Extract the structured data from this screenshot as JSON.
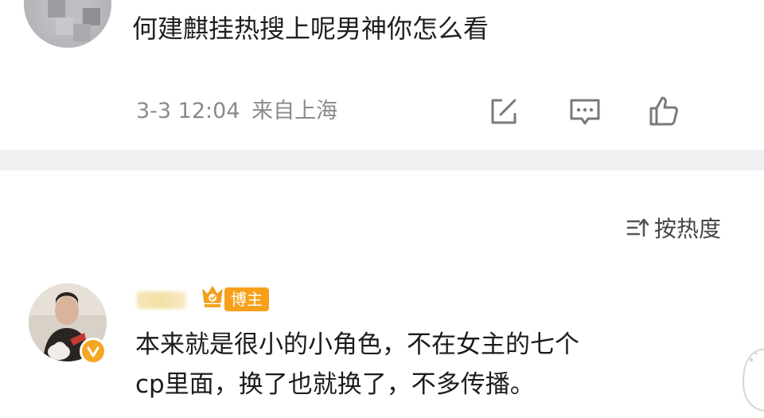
{
  "post": {
    "text": "何建麒挂热搜上呢男神你怎么看",
    "timestamp": "3-3 12:04",
    "location": "来自上海"
  },
  "actions": {
    "share_icon": "share-icon",
    "comment_icon": "comment-icon",
    "like_icon": "thumbs-up-icon"
  },
  "sort": {
    "icon": "sort-icon",
    "label": "按热度"
  },
  "comment": {
    "badge_label": "博主",
    "lines": [
      "本来就是很小的小角色，不在女主的七个",
      "cp里面，换了也就换了，不多传播。"
    ],
    "verified_icon": "verified-badge-icon",
    "crown_icon": "crown-icon"
  },
  "colors": {
    "badge": "#f7a11a",
    "verified": "#f5a623",
    "meta": "#8a8a8a",
    "divider": "#f0f0f2"
  }
}
